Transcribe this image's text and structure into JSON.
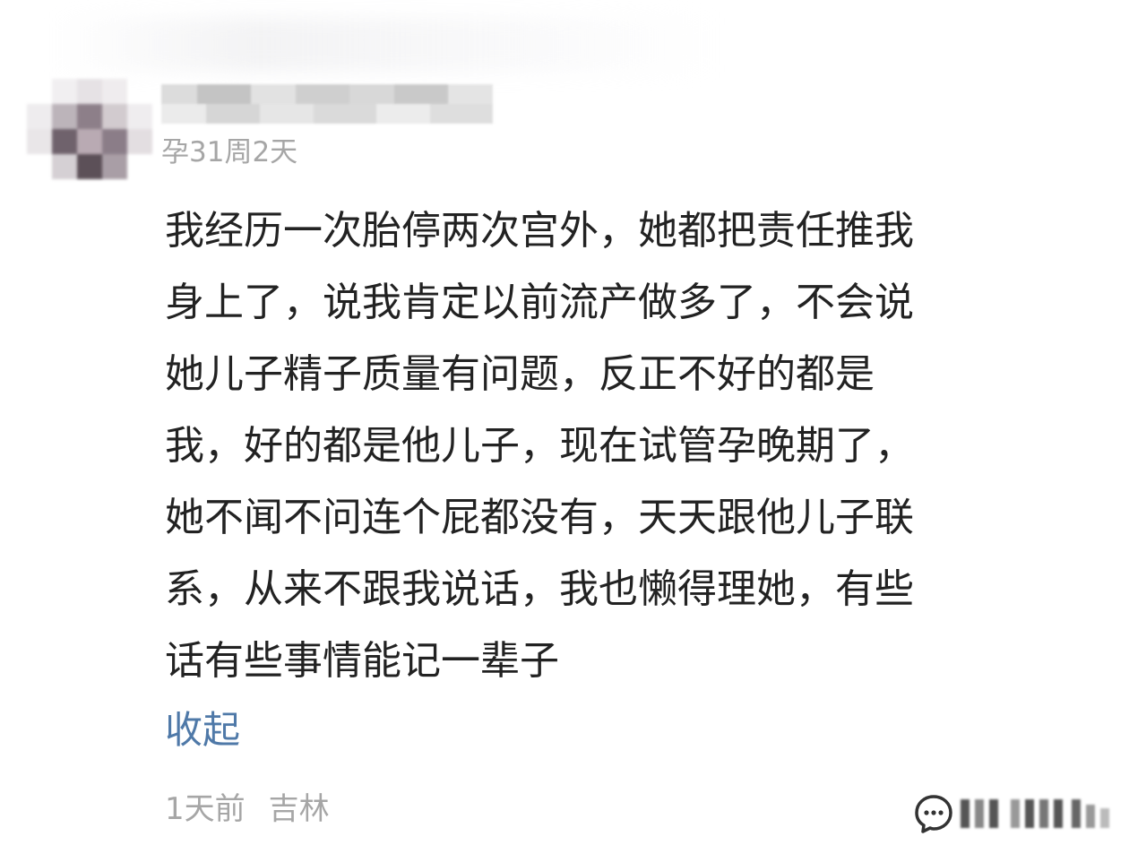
{
  "comment": {
    "author_status": "孕31周2天",
    "body_lines": [
      "我经历一次胎停两次宫外，她都把责任推我",
      "身上了，说我肯定以前流产做多了，不会说",
      "她儿子精子质量有问题，反正不好的都是",
      "我，好的都是他儿子，现在试管孕晚期了，",
      "她不闻不问连个屁都没有，天天跟他儿子联",
      "系，从来不跟我说话，我也懒得理她，有些",
      "话有些事情能记一辈子"
    ],
    "collapse_label": "收起",
    "time": "1天前",
    "location": "吉林",
    "reply_icon": "comment-bubble-icon"
  },
  "colors": {
    "text": "#222222",
    "muted": "#a6a6a6",
    "link": "#4f79a8",
    "background": "#ffffff"
  }
}
